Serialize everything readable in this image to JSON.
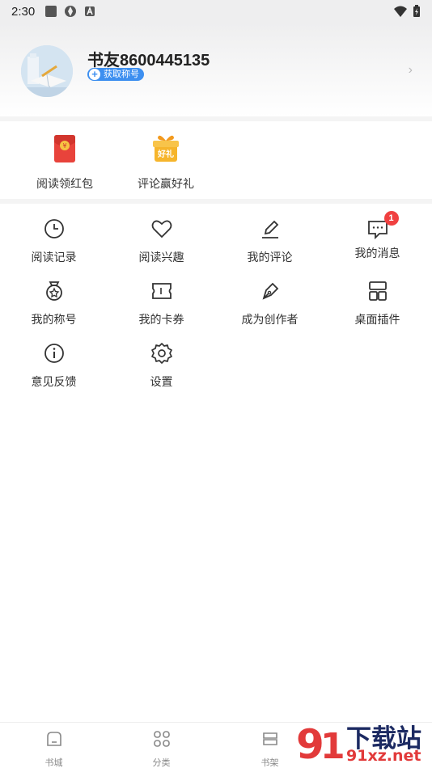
{
  "status_bar": {
    "time": "2:30"
  },
  "profile": {
    "username": "书友8600445135",
    "title_badge": "获取称号"
  },
  "promos": [
    {
      "label": "阅读领红包",
      "icon": "red-envelope-icon"
    },
    {
      "label": "评论赢好礼",
      "icon": "gift-icon",
      "icon_text": "好礼"
    }
  ],
  "menu": [
    {
      "label": "阅读记录",
      "icon": "clock-icon"
    },
    {
      "label": "阅读兴趣",
      "icon": "heart-icon"
    },
    {
      "label": "我的评论",
      "icon": "pen-icon"
    },
    {
      "label": "我的消息",
      "icon": "message-icon",
      "badge": "1"
    },
    {
      "label": "我的称号",
      "icon": "medal-icon"
    },
    {
      "label": "我的卡券",
      "icon": "coupon-icon"
    },
    {
      "label": "成为创作者",
      "icon": "fountain-pen-icon"
    },
    {
      "label": "桌面插件",
      "icon": "widget-icon"
    },
    {
      "label": "意见反馈",
      "icon": "info-icon"
    },
    {
      "label": "设置",
      "icon": "gear-icon"
    }
  ],
  "tabs": [
    {
      "label": "书城",
      "icon": "home-icon"
    },
    {
      "label": "分类",
      "icon": "grid-icon"
    },
    {
      "label": "书架",
      "icon": "shelf-icon"
    }
  ],
  "watermark": {
    "main": "下载站",
    "sub": "91xz.net"
  },
  "colors": {
    "accent": "#3d8ff0",
    "badge": "#f04040",
    "divider": "#f4f4f4"
  }
}
